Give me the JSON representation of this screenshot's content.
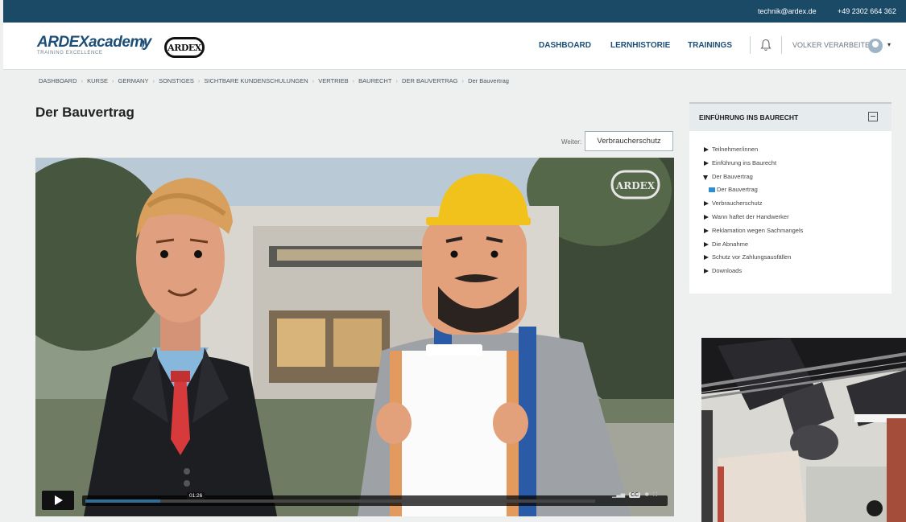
{
  "topbar": {
    "email": "technik@ardex.de",
    "phone": "+49 2302 664 362"
  },
  "brand": {
    "logo_text_main": "ARDEX",
    "logo_text_accent": "academy",
    "tagline": "TRAINING EXCELLENCE",
    "badge": "ARDEX"
  },
  "nav": {
    "items": [
      "DASHBOARD",
      "LERNHISTORIE",
      "TRAININGS"
    ],
    "user": "VOLKER VERARBEITER"
  },
  "breadcrumb": [
    "DASHBOARD",
    "KURSE",
    "GERMANY",
    "SONSTIGES",
    "SICHTBARE KUNDENSCHULUNGEN",
    "VERTRIEB",
    "BAURECHT",
    "DER BAUVERTRAG",
    "Der Bauvertrag"
  ],
  "page": {
    "title": "Der Bauvertrag",
    "next_label": "Weiter:",
    "next_button": "Verbraucherschutz"
  },
  "video": {
    "watermark": "ARDEX",
    "timecode": "01:26",
    "progress": 0.13
  },
  "sidebar": {
    "title": "EINFÜHRUNG INS BAURECHT",
    "items": [
      {
        "label": "Teilnehmer/innen",
        "type": "collapsed"
      },
      {
        "label": "Einführung ins Baurecht",
        "type": "collapsed"
      },
      {
        "label": "Der Bauvertrag",
        "type": "expanded"
      },
      {
        "label": "Der Bauvertrag",
        "type": "sub"
      },
      {
        "label": "Verbraucherschutz",
        "type": "collapsed"
      },
      {
        "label": "Wann haftet der Handwerker",
        "type": "collapsed"
      },
      {
        "label": "Reklamation wegen Sachmangels",
        "type": "collapsed"
      },
      {
        "label": "Die Abnahme",
        "type": "collapsed"
      },
      {
        "label": "Schutz vor Zahlungsausfällen",
        "type": "collapsed"
      },
      {
        "label": "Downloads",
        "type": "collapsed"
      }
    ]
  },
  "colors": {
    "topbar": "#1b4a66",
    "brand": "#1d4e78",
    "accent": "#2d8fd0",
    "helmet": "#f1c21b",
    "tie": "#d63a3a"
  }
}
